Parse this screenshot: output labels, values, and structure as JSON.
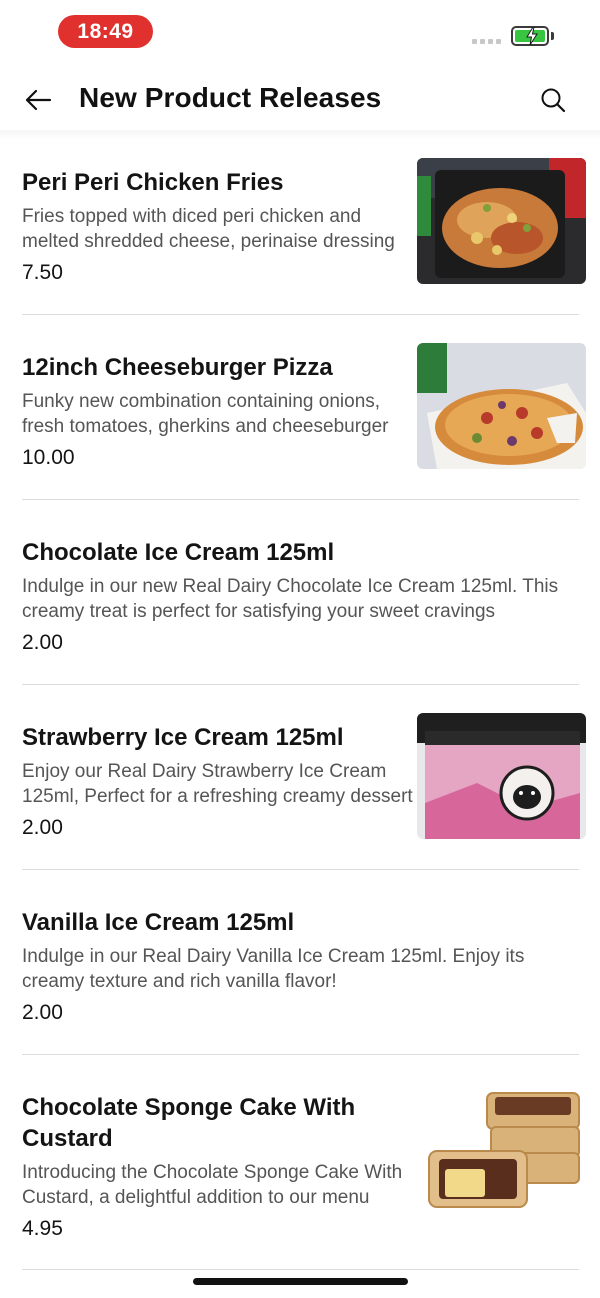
{
  "status_bar": {
    "time": "18:49",
    "time_pill_color": "#e0312f",
    "battery_color": "#38c640",
    "icons": [
      "signal-icon",
      "battery-charging-icon"
    ]
  },
  "header": {
    "title": "New Product Releases",
    "back_icon": "back-arrow-icon",
    "search_icon": "search-icon"
  },
  "products": [
    {
      "name": "Peri Peri Chicken Fries",
      "description": "Fries topped with diced peri chicken and melted shredded cheese, perinaise dressing",
      "price": "7.50",
      "has_image": true
    },
    {
      "name": "12inch Cheeseburger Pizza",
      "description": "Funky new combination containing onions, fresh tomatoes, gherkins and cheeseburger",
      "price": "10.00",
      "has_image": true
    },
    {
      "name": "Chocolate Ice Cream 125ml",
      "description": "Indulge in our new Real Dairy Chocolate Ice Cream 125ml. This creamy treat is perfect for satisfying your sweet cravings",
      "price": "2.00",
      "has_image": false
    },
    {
      "name": "Strawberry Ice Cream 125ml",
      "description": "Enjoy our Real Dairy Strawberry Ice Cream 125ml, Perfect for a refreshing creamy dessert",
      "price": "2.00",
      "has_image": true
    },
    {
      "name": "Vanilla Ice Cream 125ml",
      "description": "Indulge in our Real Dairy Vanilla Ice Cream 125ml. Enjoy its creamy texture and rich vanilla flavor!",
      "price": "2.00",
      "has_image": false
    },
    {
      "name": "Chocolate Sponge Cake With Custard",
      "description": "Introducing the Chocolate Sponge Cake With Custard, a delightful addition to our menu",
      "price": "4.95",
      "has_image": true
    }
  ]
}
